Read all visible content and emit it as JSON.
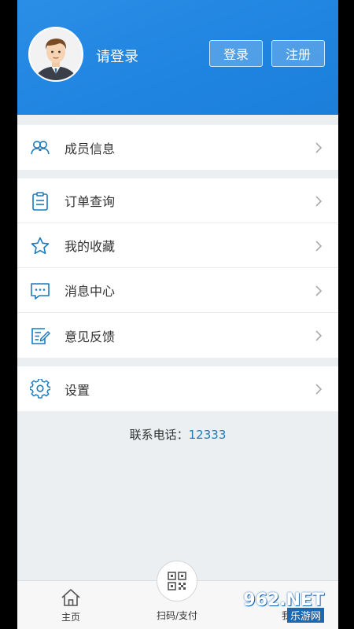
{
  "header": {
    "login_hint": "请登录",
    "login_button": "登录",
    "register_button": "注册"
  },
  "menu": {
    "members": {
      "label": "成员信息",
      "icon": "members-icon"
    },
    "orders": {
      "label": "订单查询",
      "icon": "clipboard-icon"
    },
    "favorites": {
      "label": "我的收藏",
      "icon": "star-icon"
    },
    "messages": {
      "label": "消息中心",
      "icon": "chat-bubble-icon"
    },
    "feedback": {
      "label": "意见反馈",
      "icon": "edit-note-icon"
    },
    "settings": {
      "label": "设置",
      "icon": "gear-icon"
    }
  },
  "contact": {
    "label": "联系电话：",
    "number": "12333"
  },
  "tabbar": {
    "home": "主页",
    "scan": "扫码/支付",
    "mine": "我的"
  },
  "watermark": {
    "text": "962.NET",
    "sub": "乐游网"
  },
  "colors": {
    "header": "#1f84e0",
    "icon": "#1a7bbf",
    "link": "#1a7bbf"
  }
}
